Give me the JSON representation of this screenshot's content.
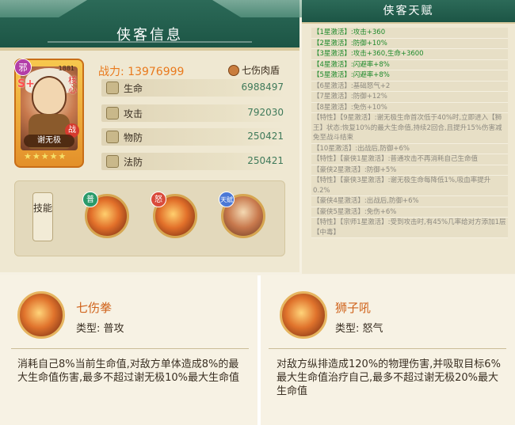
{
  "hero_info": {
    "title": "侠客信息",
    "card": {
      "faction": "邪",
      "rank": "S+",
      "core": "核心",
      "war": "战",
      "name": "谢无极",
      "stars": "★★★★★",
      "id": "1881"
    },
    "power_label": "战力:",
    "power_value": "13976999",
    "skill_tag": "七伤肉盾",
    "stats": [
      {
        "name": "生命",
        "value": "6988497",
        "icon": "heart-icon"
      },
      {
        "name": "攻击",
        "value": "792030",
        "icon": "sword-icon"
      },
      {
        "name": "物防",
        "value": "250421",
        "icon": "shield-icon"
      },
      {
        "name": "法防",
        "value": "250421",
        "icon": "magic-shield-icon"
      }
    ],
    "skills_button": "技能",
    "skills": [
      {
        "badge": "普",
        "badge_color": "#2a9a6a",
        "icon": "fist-skill-icon"
      },
      {
        "badge": "怒",
        "badge_color": "#d94a3a",
        "icon": "lion-roar-skill-icon"
      },
      {
        "badge": "天赋",
        "badge_color": "#4a78d6",
        "icon": "talent-portrait-icon"
      }
    ]
  },
  "talent": {
    "title": "侠客天赋",
    "items": [
      {
        "pre": "【1星激活】:",
        "text": "攻击+360",
        "active": true
      },
      {
        "pre": "【2星激活】:",
        "text": "防御+10%",
        "active": true
      },
      {
        "pre": "【3星激活】:",
        "text": "攻击+360,生命+3600",
        "active": true
      },
      {
        "pre": "【4星激活】:",
        "text": "闪避率+8%",
        "active": true
      },
      {
        "pre": "【5星激活】:",
        "text": "闪避率+8%",
        "active": true
      },
      {
        "pre": "【6星激活】:",
        "text": "基础怒气+2",
        "active": false
      },
      {
        "pre": "【7星激活】:",
        "text": "防御+12%",
        "active": false
      },
      {
        "pre": "【8星激活】:",
        "text": "免伤+10%",
        "active": false
      },
      {
        "pre": "【特性】",
        "text": "【9星激活】:谢无极生命首次低于40%时,立即进入【狮王】状态:恢复10%的最大生命值,持续2回合,且提升15%伤害减免至战斗结束",
        "active": false
      },
      {
        "pre": "【10星激活】:",
        "text": "出战后,防御+6%",
        "active": false
      },
      {
        "pre": "【特性】",
        "text": "【豪侠1星激活】:普通攻击不再消耗自己生命值",
        "active": false
      },
      {
        "pre": "【豪侠2星激活】:",
        "text": "防御+5%",
        "active": false
      },
      {
        "pre": "【特性】",
        "text": "【豪侠3星激活】:谢无极生命每降低1%,吸血率提升0.2%",
        "active": false
      },
      {
        "pre": "【豪侠4星激活】:",
        "text": "出战后,防御+6%",
        "active": false
      },
      {
        "pre": "【豪侠5星激活】:",
        "text": "免伤+6%",
        "active": false
      },
      {
        "pre": "【特性】",
        "text": "【宗师1星激活】:受到攻击时,有45%几率给对方添加1层【中毒】",
        "active": false
      }
    ]
  },
  "skill_detail_left": {
    "name": "七伤拳",
    "type_label": "类型:",
    "type_value": "普攻",
    "description": "消耗自己8%当前生命值,对敌方单体造成8%的最大生命值伤害,最多不超过谢无极10%最大生命值"
  },
  "skill_detail_right": {
    "name": "狮子吼",
    "type_label": "类型:",
    "type_value": "怒气",
    "description": "对敌方纵排造成120%的物理伤害,并吸取目标6%最大生命值治疗自己,最多不超过谢无极20%最大生命值"
  }
}
